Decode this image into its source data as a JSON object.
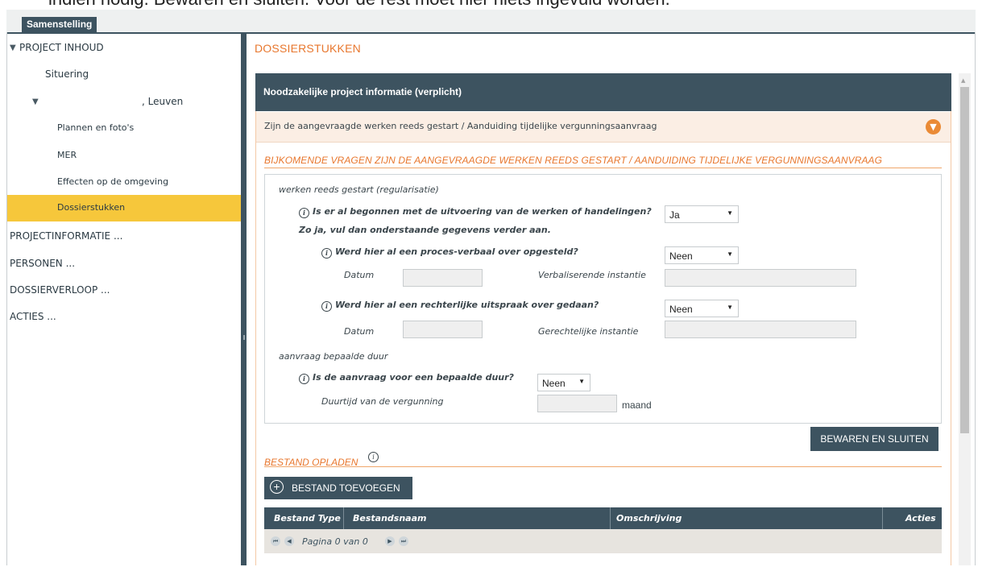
{
  "top_caption": "indien nodig. Bewaren en sluiten. Voor de rest moet hier niets ingevuld worden.",
  "tab": {
    "label": "Samenstelling"
  },
  "sidebar": {
    "items": [
      {
        "label": "PROJECT INHOUD",
        "expanded": true
      },
      {
        "label": "Situering"
      },
      {
        "label": ", Leuven",
        "expanded": true
      },
      {
        "label": "Plannen en foto's"
      },
      {
        "label": "MER"
      },
      {
        "label": "Effecten op de omgeving"
      },
      {
        "label": "Dossierstukken",
        "active": true
      },
      {
        "label": "PROJECTINFORMATIE ..."
      },
      {
        "label": "PERSONEN ..."
      },
      {
        "label": "DOSSIERVERLOOP ..."
      },
      {
        "label": "ACTIES ..."
      }
    ]
  },
  "main": {
    "title": "DOSSIERSTUKKEN",
    "panel_header": "Noodzakelijke project informatie (verplicht)",
    "accordion_label": "Zijn de aangevraagde werken reeds gestart / Aanduiding tijdelijke vergunningsaanvraag",
    "section_title": "BIJKOMENDE VRAGEN ZIJN DE AANGEVRAAGDE WERKEN REEDS GESTART / AANDUIDING TIJDELIJKE VERGUNNINGSAANVRAAG",
    "form": {
      "group1_label": "werken reeds gestart (regularisatie)",
      "q1_label": "Is er al begonnen met de uitvoering van de werken of handelingen?",
      "q1_note": "Zo ja, vul dan onderstaande gegevens verder aan.",
      "q1_value": "Ja",
      "q2_label": "Werd hier al een proces-verbaal over opgesteld?",
      "q2_value": "Neen",
      "datum_label": "Datum",
      "verbaliserende_label": "Verbaliserende instantie",
      "q3_label": "Werd hier al een rechterlijke uitspraak over gedaan?",
      "q3_value": "Neen",
      "datum2_label": "Datum",
      "gerechtelijke_label": "Gerechtelijke instantie",
      "group2_label": "aanvraag bepaalde duur",
      "q4_label": "Is de aanvraag voor een bepaalde duur?",
      "q4_value": "Neen",
      "duurtijd_label": "Duurtijd van de vergunning",
      "duurtijd_unit": "maand"
    },
    "save_button": "BEWAREN EN SLUITEN",
    "upload": {
      "title": "BESTAND OPLADEN",
      "add_button": "BESTAND TOEVOEGEN",
      "columns": [
        "Bestand Type",
        "Bestandsnaam",
        "Omschrijving",
        "Acties"
      ],
      "pager_text": "Pagina 0 van 0"
    }
  },
  "colors": {
    "accent": "#e8772e",
    "dark": "#3d5360",
    "active": "#f6c73b"
  }
}
